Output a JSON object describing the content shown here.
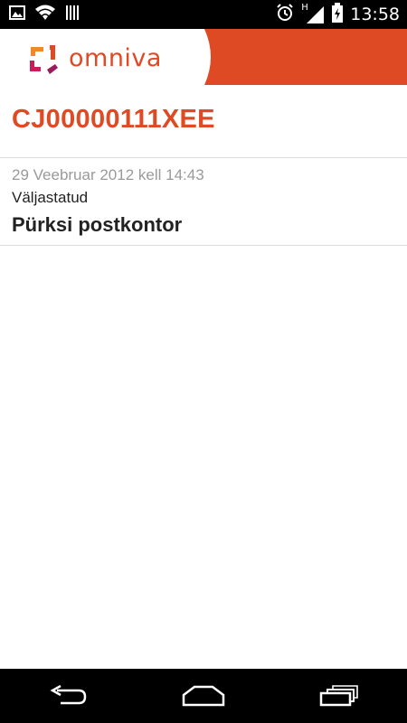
{
  "status_bar": {
    "time": "13:58",
    "network_type": "H",
    "icons": [
      "image-icon",
      "wifi-icon",
      "barcode-icon",
      "alarm-icon",
      "signal-icon",
      "battery-icon"
    ]
  },
  "header": {
    "logo_text": "omniva",
    "brand_color": "#de4a23"
  },
  "shipment": {
    "tracking_code": "CJ00000111XEE",
    "events": [
      {
        "date": "29 Veebruar 2012 kell 14:43",
        "status": "Väljastatud",
        "location": "Pürksi postkontor"
      }
    ]
  },
  "nav_bar": {
    "buttons": [
      "back-icon",
      "home-icon",
      "recents-icon"
    ]
  }
}
